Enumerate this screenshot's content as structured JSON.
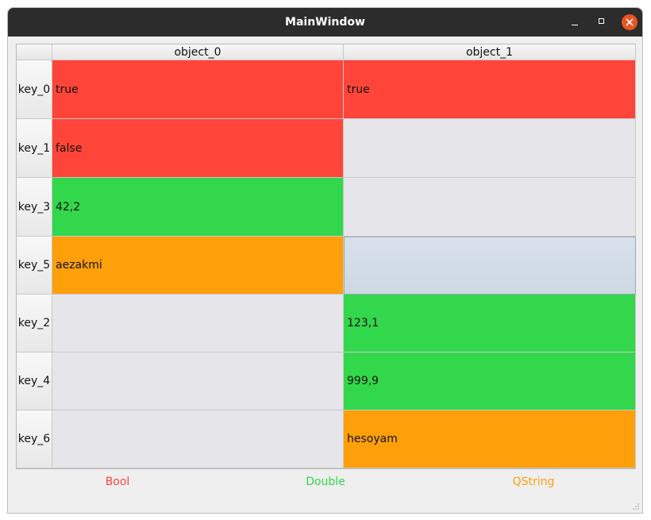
{
  "window": {
    "title": "MainWindow"
  },
  "table": {
    "columns": [
      "object_0",
      "object_1"
    ],
    "rows": [
      {
        "key": "key_0",
        "cells": [
          "true",
          "true"
        ]
      },
      {
        "key": "key_1",
        "cells": [
          "false",
          ""
        ]
      },
      {
        "key": "key_3",
        "cells": [
          "42,2",
          ""
        ]
      },
      {
        "key": "key_5",
        "cells": [
          "aezakmi",
          ""
        ]
      },
      {
        "key": "key_2",
        "cells": [
          "",
          "123,1"
        ]
      },
      {
        "key": "key_4",
        "cells": [
          "",
          "999,9"
        ]
      },
      {
        "key": "key_6",
        "cells": [
          "",
          "hesoyam"
        ]
      }
    ],
    "cell_types": [
      [
        "Bool",
        "Bool"
      ],
      [
        "Bool",
        "none"
      ],
      [
        "Double",
        "none"
      ],
      [
        "QString",
        "selected"
      ],
      [
        "none",
        "Double"
      ],
      [
        "none",
        "Double"
      ],
      [
        "none",
        "QString"
      ]
    ]
  },
  "legend": {
    "bool_label": "Bool",
    "double_label": "Double",
    "qstring_label": "QString"
  },
  "colors": {
    "bool": "#ff4539",
    "double": "#32d74b",
    "qstring": "#ff9f0a",
    "empty": "#e6e5e9",
    "selected": "#d0dae6",
    "titlebar": "#2c2c2c",
    "close_button": "#e95420"
  },
  "icons": {
    "minimize": "minimize-icon",
    "maximize": "maximize-icon",
    "close": "close-icon",
    "resize": "resize-grip-icon"
  }
}
